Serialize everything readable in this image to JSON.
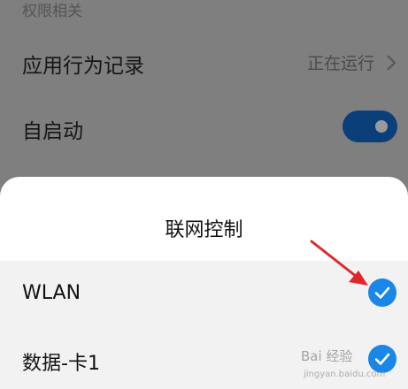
{
  "settings": {
    "section_header": "权限相关",
    "app_behavior_label": "应用行为记录",
    "app_behavior_value": "正在运行",
    "autostart_label": "自启动",
    "autostart_enabled": true
  },
  "sheet": {
    "title": "联网控制",
    "options": [
      {
        "label": "WLAN",
        "checked": true
      },
      {
        "label": "数据-卡1",
        "checked": true
      }
    ]
  },
  "watermark": {
    "main": "Bai  经验",
    "sub": "jingyan.baidu.com"
  },
  "colors": {
    "accent": "#1a86e8",
    "toggle_on": "#0b3f7a",
    "annotation_arrow": "#e0282c"
  },
  "icons": [
    "chevron-right-icon",
    "checkmark-icon",
    "toggle-switch",
    "annotation-arrow"
  ]
}
